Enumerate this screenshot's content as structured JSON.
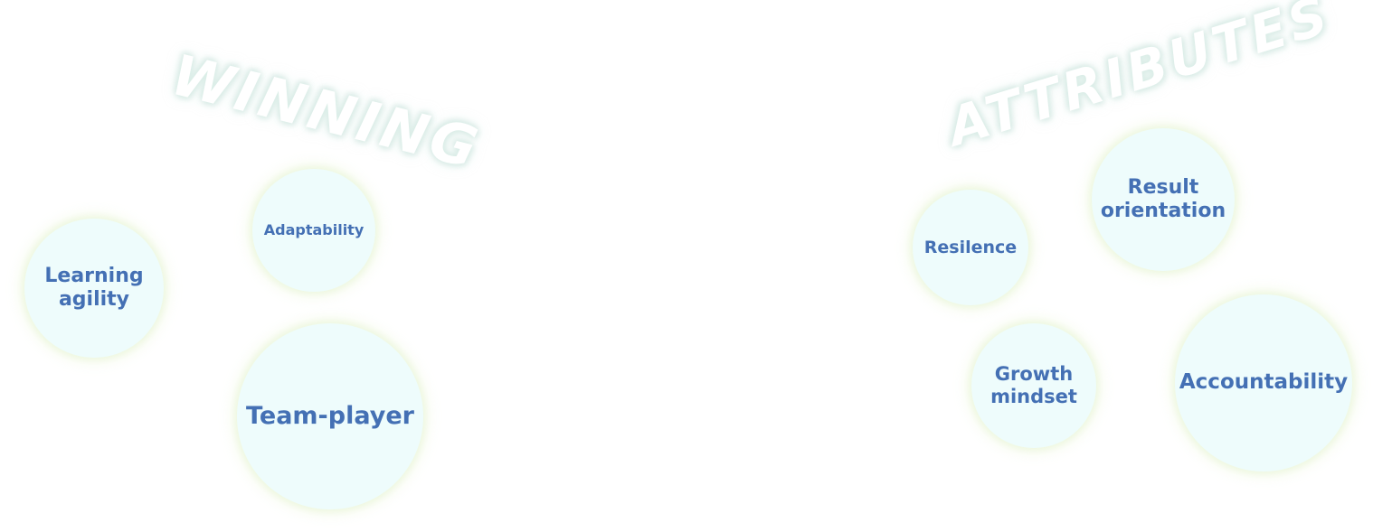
{
  "headline": {
    "word_left": "WINNING",
    "word_right": "ATTRIBUTES"
  },
  "colors": {
    "bubble_fill": "#eefcfc",
    "bubble_glow": "#eef8e2",
    "label_text": "#4470b4",
    "background": "#ffffff"
  },
  "attributes": {
    "learning_agility": "Learning\nagility",
    "adaptability": "Adaptability",
    "team_player": "Team-player",
    "resilence": "Resilence",
    "result_orientation": "Result\norientation",
    "growth_mindset": "Growth\nmindset",
    "accountability": "Accountability"
  }
}
